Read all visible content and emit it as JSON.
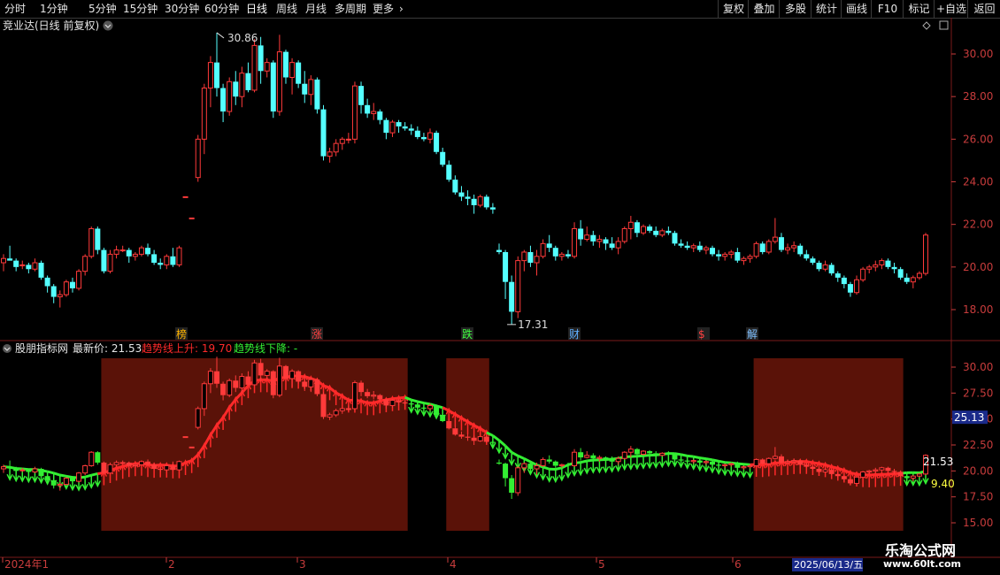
{
  "toolbar": {
    "periods": [
      "分时",
      "1分钟",
      "5分钟",
      "15分钟",
      "30分钟",
      "60分钟",
      "日线",
      "周线",
      "月线",
      "多周期",
      "更多"
    ],
    "active_period": "日线",
    "right_buttons": [
      "复权",
      "叠加",
      "多股",
      "统计",
      "画线",
      "F10",
      "标记",
      "+自选",
      "返回"
    ]
  },
  "main_panel": {
    "title": "竞业达(日线 前复权)",
    "price_axis": [
      "30.00",
      "28.00",
      "26.00",
      "24.00",
      "22.00",
      "20.00",
      "18.00"
    ],
    "high_label": "30.86",
    "low_label": "17.31",
    "event_markers": [
      {
        "label": "榜",
        "color": "#ffb400"
      },
      {
        "label": "涨",
        "color": "#ff4040"
      },
      {
        "label": "跌",
        "color": "#40ff40"
      },
      {
        "label": "财",
        "color": "#60b0ff"
      },
      {
        "label": "$",
        "color": "#ff4040"
      },
      {
        "label": "解",
        "color": "#80c0ff"
      }
    ]
  },
  "indicator_panel": {
    "name": "股朋指标网",
    "latest_label": "最新价: 21.53",
    "up_label": "趋势线上升: 19.70",
    "down_label": "趋势线下降: -",
    "price_axis": [
      "30.00",
      "27.50",
      "25.00",
      "22.50",
      "20.00",
      "17.50",
      "15.00"
    ],
    "axis_badge": "25.13",
    "last_price_label": "21.53",
    "trend_value_label": "9.40"
  },
  "date_axis": {
    "labels": [
      "2024年1",
      "2",
      "3",
      "4",
      "5",
      "6"
    ],
    "current_date": "2025/06/13/五"
  },
  "watermark": {
    "name": "乐淘公式网",
    "url": "www.60lt.com"
  },
  "colors": {
    "up": "#ff3a3a",
    "down": "#54ffff",
    "trend_up": "#ff2a2a",
    "trend_down": "#33ee33",
    "zone": "#5a1208",
    "axis_text": "#c83c3c",
    "grid": "#7a1a1a"
  },
  "chart_data": {
    "type": "candlestick",
    "title": "竞业达(日线 前复权)",
    "x_start": "2024年1",
    "y_range": [
      17,
      31.5
    ],
    "candles_ohlc": [
      [
        20.2,
        20.6,
        19.8,
        20.4
      ],
      [
        20.4,
        21.0,
        20.3,
        20.3
      ],
      [
        20.3,
        20.4,
        19.8,
        20.0
      ],
      [
        20.1,
        20.3,
        19.9,
        20.1
      ],
      [
        20.1,
        20.2,
        19.7,
        19.9
      ],
      [
        19.9,
        20.4,
        19.8,
        20.2
      ],
      [
        20.2,
        20.3,
        19.4,
        19.5
      ],
      [
        19.5,
        19.6,
        18.8,
        19.1
      ],
      [
        19.1,
        19.2,
        18.3,
        18.6
      ],
      [
        18.6,
        18.9,
        18.1,
        18.7
      ],
      [
        18.7,
        19.4,
        18.6,
        19.3
      ],
      [
        19.3,
        19.5,
        18.8,
        19.0
      ],
      [
        19.0,
        19.9,
        18.9,
        19.8
      ],
      [
        19.8,
        20.6,
        19.6,
        20.5
      ],
      [
        20.5,
        21.9,
        20.4,
        21.8
      ],
      [
        21.8,
        21.9,
        20.6,
        20.8
      ],
      [
        20.8,
        20.9,
        19.7,
        19.8
      ],
      [
        19.8,
        20.8,
        19.7,
        20.6
      ],
      [
        20.6,
        21.0,
        20.4,
        20.8
      ],
      [
        20.8,
        21.0,
        20.7,
        20.8
      ],
      [
        20.8,
        20.9,
        20.2,
        20.5
      ],
      [
        20.5,
        20.7,
        20.3,
        20.6
      ],
      [
        20.6,
        21.0,
        20.5,
        20.9
      ],
      [
        20.9,
        21.1,
        20.5,
        20.6
      ],
      [
        20.6,
        20.8,
        20.1,
        20.2
      ],
      [
        20.2,
        20.4,
        19.9,
        20.1
      ],
      [
        20.1,
        20.6,
        19.9,
        20.5
      ],
      [
        20.5,
        20.9,
        20.0,
        20.1
      ],
      [
        20.1,
        21.0,
        20.0,
        20.9
      ],
      [
        23.3,
        23.3,
        23.3,
        23.3
      ],
      [
        22.3,
        22.3,
        22.3,
        22.3
      ],
      [
        24.2,
        26.2,
        24.0,
        26.0
      ],
      [
        26.0,
        28.6,
        25.3,
        28.4
      ],
      [
        28.4,
        29.9,
        27.5,
        29.6
      ],
      [
        29.6,
        31.0,
        28.0,
        28.4
      ],
      [
        28.4,
        28.6,
        26.8,
        27.3
      ],
      [
        27.3,
        28.9,
        27.1,
        28.7
      ],
      [
        28.7,
        29.2,
        27.6,
        28.0
      ],
      [
        28.0,
        29.4,
        27.5,
        29.1
      ],
      [
        29.1,
        29.6,
        28.2,
        28.3
      ],
      [
        28.3,
        30.7,
        28.2,
        30.4
      ],
      [
        30.4,
        30.8,
        28.6,
        29.2
      ],
      [
        29.2,
        29.8,
        28.9,
        29.6
      ],
      [
        29.6,
        29.7,
        27.0,
        27.3
      ],
      [
        27.3,
        30.9,
        27.1,
        30.1
      ],
      [
        30.1,
        30.2,
        28.6,
        28.9
      ],
      [
        28.9,
        29.8,
        28.1,
        29.6
      ],
      [
        29.6,
        29.7,
        28.4,
        28.6
      ],
      [
        28.6,
        29.2,
        27.7,
        28.1
      ],
      [
        28.1,
        29.0,
        27.6,
        28.8
      ],
      [
        28.8,
        28.9,
        27.2,
        27.4
      ],
      [
        27.4,
        27.6,
        25.0,
        25.2
      ],
      [
        25.2,
        25.6,
        24.9,
        25.4
      ],
      [
        25.4,
        26.0,
        25.2,
        25.8
      ],
      [
        25.8,
        26.1,
        25.5,
        26.0
      ],
      [
        26.0,
        26.3,
        25.8,
        26.0
      ],
      [
        26.0,
        28.7,
        25.8,
        28.5
      ],
      [
        28.5,
        28.7,
        27.2,
        27.6
      ],
      [
        27.6,
        27.9,
        27.0,
        27.2
      ],
      [
        27.2,
        27.7,
        26.9,
        27.3
      ],
      [
        27.3,
        27.4,
        26.7,
        26.9
      ],
      [
        26.9,
        27.0,
        26.0,
        26.3
      ],
      [
        26.3,
        26.9,
        26.1,
        26.8
      ],
      [
        26.8,
        26.9,
        26.3,
        26.6
      ],
      [
        26.6,
        26.8,
        26.4,
        26.5
      ],
      [
        26.5,
        26.7,
        26.2,
        26.4
      ],
      [
        26.4,
        26.6,
        26.0,
        26.1
      ],
      [
        26.1,
        26.3,
        25.9,
        26.0
      ],
      [
        26.0,
        26.5,
        25.8,
        26.3
      ],
      [
        26.3,
        26.4,
        25.3,
        25.4
      ],
      [
        25.4,
        25.6,
        24.7,
        24.8
      ],
      [
        24.8,
        25.0,
        24.0,
        24.1
      ],
      [
        24.1,
        24.3,
        23.4,
        23.5
      ],
      [
        23.5,
        23.8,
        23.1,
        23.3
      ],
      [
        23.3,
        23.6,
        22.9,
        23.2
      ],
      [
        23.2,
        23.4,
        22.5,
        22.9
      ],
      [
        22.9,
        23.4,
        22.8,
        23.3
      ],
      [
        23.3,
        23.4,
        22.7,
        22.8
      ],
      [
        22.8,
        23.0,
        22.5,
        22.7
      ],
      [
        20.8,
        21.1,
        20.6,
        20.7
      ],
      [
        20.7,
        20.8,
        18.5,
        19.3
      ],
      [
        19.3,
        19.6,
        17.3,
        17.9
      ],
      [
        17.9,
        20.5,
        17.6,
        20.3
      ],
      [
        20.3,
        20.8,
        19.8,
        20.7
      ],
      [
        20.7,
        21.0,
        20.0,
        20.2
      ],
      [
        20.2,
        20.8,
        19.6,
        20.5
      ],
      [
        20.5,
        21.3,
        20.4,
        21.1
      ],
      [
        21.1,
        21.5,
        20.7,
        20.9
      ],
      [
        20.9,
        21.0,
        20.3,
        20.5
      ],
      [
        20.5,
        20.7,
        20.3,
        20.6
      ],
      [
        20.6,
        20.8,
        20.4,
        20.5
      ],
      [
        20.5,
        22.1,
        20.4,
        21.8
      ],
      [
        21.8,
        22.2,
        21.0,
        21.3
      ],
      [
        21.3,
        21.9,
        21.2,
        21.5
      ],
      [
        21.5,
        21.7,
        21.0,
        21.2
      ],
      [
        21.2,
        21.5,
        20.9,
        21.3
      ],
      [
        21.3,
        21.4,
        20.8,
        21.1
      ],
      [
        21.1,
        21.4,
        20.8,
        20.9
      ],
      [
        20.9,
        21.4,
        20.6,
        21.2
      ],
      [
        21.2,
        21.9,
        21.1,
        21.8
      ],
      [
        21.8,
        22.4,
        21.3,
        22.1
      ],
      [
        22.1,
        22.2,
        21.4,
        21.6
      ],
      [
        21.6,
        22.0,
        21.5,
        21.9
      ],
      [
        21.9,
        22.0,
        21.6,
        21.7
      ],
      [
        21.7,
        21.9,
        21.4,
        21.5
      ],
      [
        21.5,
        21.8,
        21.4,
        21.7
      ],
      [
        21.7,
        21.9,
        21.5,
        21.6
      ],
      [
        21.6,
        21.7,
        21.0,
        21.1
      ],
      [
        21.1,
        21.3,
        20.9,
        21.0
      ],
      [
        21.0,
        21.2,
        20.8,
        20.9
      ],
      [
        20.9,
        21.1,
        20.7,
        21.0
      ],
      [
        21.0,
        21.2,
        20.7,
        20.8
      ],
      [
        20.8,
        21.0,
        20.6,
        20.9
      ],
      [
        20.9,
        21.0,
        20.5,
        20.6
      ],
      [
        20.6,
        20.8,
        20.3,
        20.5
      ],
      [
        20.5,
        20.7,
        20.3,
        20.6
      ],
      [
        20.6,
        20.8,
        20.4,
        20.7
      ],
      [
        20.7,
        20.9,
        20.2,
        20.3
      ],
      [
        20.3,
        20.5,
        20.1,
        20.4
      ],
      [
        20.4,
        20.6,
        20.2,
        20.5
      ],
      [
        20.5,
        21.2,
        20.4,
        21.1
      ],
      [
        21.1,
        21.2,
        20.6,
        20.7
      ],
      [
        20.7,
        21.3,
        20.6,
        21.2
      ],
      [
        21.2,
        22.3,
        21.1,
        21.4
      ],
      [
        21.4,
        21.6,
        20.7,
        20.8
      ],
      [
        20.8,
        21.1,
        20.6,
        20.9
      ],
      [
        20.9,
        21.2,
        20.7,
        21.0
      ],
      [
        21.0,
        21.1,
        20.5,
        20.6
      ],
      [
        20.6,
        20.8,
        20.3,
        20.4
      ],
      [
        20.4,
        20.5,
        20.1,
        20.2
      ],
      [
        20.2,
        20.3,
        19.8,
        19.9
      ],
      [
        19.9,
        20.3,
        19.8,
        20.1
      ],
      [
        20.1,
        20.2,
        19.6,
        19.7
      ],
      [
        19.7,
        19.8,
        19.3,
        19.5
      ],
      [
        19.5,
        19.6,
        19.0,
        19.2
      ],
      [
        19.2,
        19.3,
        18.6,
        18.8
      ],
      [
        18.8,
        19.6,
        18.7,
        19.4
      ],
      [
        19.4,
        20.0,
        19.3,
        19.9
      ],
      [
        19.9,
        20.1,
        19.7,
        20.0
      ],
      [
        20.0,
        20.3,
        19.8,
        20.1
      ],
      [
        20.1,
        20.4,
        19.9,
        20.3
      ],
      [
        20.3,
        20.4,
        19.9,
        20.0
      ],
      [
        20.0,
        20.2,
        19.7,
        19.9
      ],
      [
        19.9,
        20.0,
        19.4,
        19.5
      ],
      [
        19.5,
        19.7,
        19.2,
        19.3
      ],
      [
        19.3,
        19.6,
        19.0,
        19.5
      ],
      [
        19.5,
        19.8,
        19.4,
        19.7
      ],
      [
        19.7,
        21.6,
        19.6,
        21.5
      ]
    ]
  }
}
